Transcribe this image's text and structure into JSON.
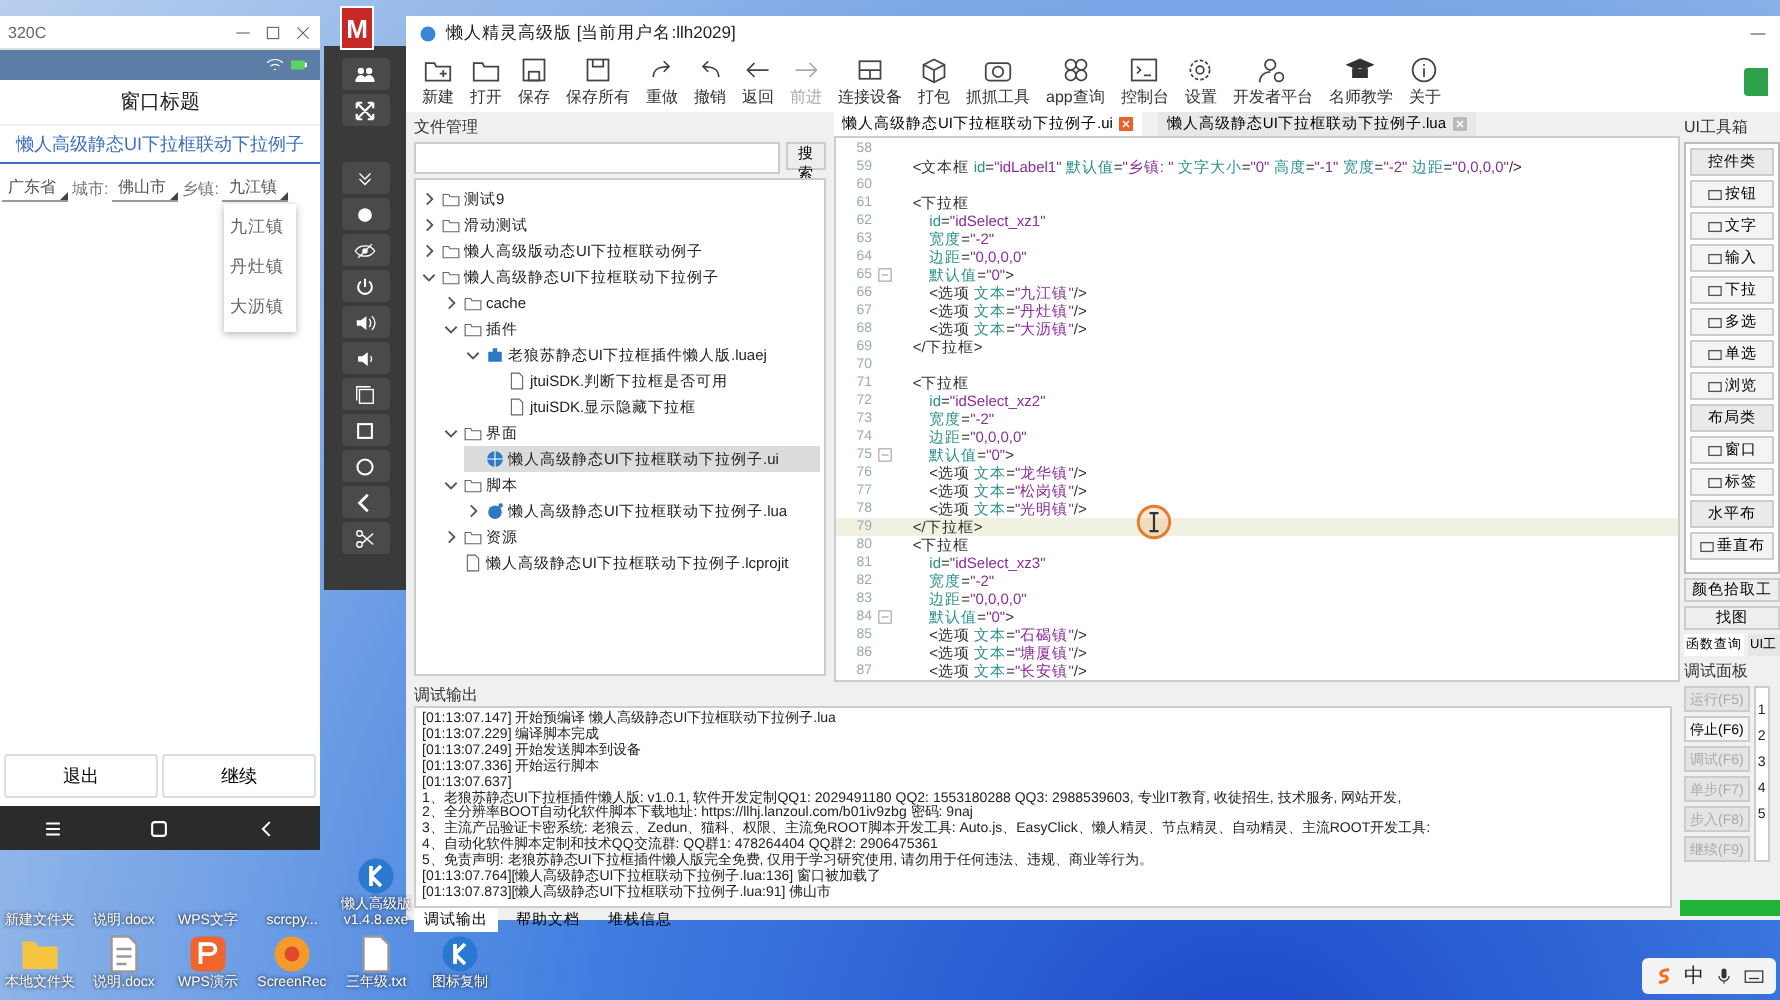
{
  "phone_window": {
    "title": "320C",
    "header": "窗口标题",
    "subtitle": "懒人高级静态UI下拉框联动下拉例子",
    "controls": [
      {
        "kind": "select",
        "text": "广东省"
      },
      {
        "kind": "label",
        "text": "城市:"
      },
      {
        "kind": "select",
        "text": "佛山市"
      },
      {
        "kind": "label",
        "text": "乡镇:"
      },
      {
        "kind": "select",
        "text": "九江镇"
      }
    ],
    "dropdown": [
      {
        "label": "九江镇",
        "selected": false
      },
      {
        "label": "丹灶镇",
        "selected": false
      },
      {
        "label": "大沥镇",
        "selected": false
      }
    ],
    "buttons": [
      "退出",
      "继续"
    ]
  },
  "desktop_badge": "M",
  "ide": {
    "title": "懒人精灵高级版 [当前用户名:llh2029]",
    "toolbar": [
      {
        "label": "新建",
        "disabled": false
      },
      {
        "label": "打开",
        "disabled": false
      },
      {
        "label": "保存",
        "disabled": false
      },
      {
        "label": "保存所有",
        "disabled": false
      },
      {
        "label": "重做",
        "disabled": false
      },
      {
        "label": "撤销",
        "disabled": false
      },
      {
        "label": "返回",
        "disabled": false
      },
      {
        "label": "前进",
        "disabled": true
      },
      {
        "label": "连接设备",
        "disabled": false
      },
      {
        "label": "打包",
        "disabled": false
      },
      {
        "label": "抓抓工具",
        "disabled": false
      },
      {
        "label": "app查询",
        "disabled": false
      },
      {
        "label": "控制台",
        "disabled": false
      },
      {
        "label": "设置",
        "disabled": false
      },
      {
        "label": "开发者平台",
        "disabled": false
      },
      {
        "label": "名师教学",
        "disabled": false
      },
      {
        "label": "关于",
        "disabled": false
      }
    ],
    "file_panel": {
      "title": "文件管理",
      "search_button": "搜索",
      "tree": [
        {
          "label": "测试9",
          "kind": "folder",
          "expanded": false,
          "selected": false
        },
        {
          "label": "滑动测试",
          "kind": "folder",
          "expanded": false,
          "selected": false
        },
        {
          "label": "懒人高级版动态UI下拉框联动例子",
          "kind": "folder",
          "expanded": false,
          "selected": false
        },
        {
          "label": "懒人高级静态UI下拉框联动下拉例子",
          "kind": "folder",
          "expanded": true,
          "selected": false,
          "children": [
            {
              "label": "cache",
              "kind": "folder",
              "expanded": false,
              "selected": false
            },
            {
              "label": "插件",
              "kind": "folder",
              "expanded": true,
              "selected": false,
              "children": [
                {
                  "label": "老狼苏静态UI下拉框插件懒人版.luaej",
                  "kind": "plugin",
                  "expanded": true,
                  "selected": false,
                  "children": [
                    {
                      "label": "jtuiSDK.判断下拉框是否可用",
                      "kind": "file",
                      "selected": false
                    },
                    {
                      "label": "jtuiSDK.显示隐藏下拉框",
                      "kind": "file",
                      "selected": false
                    }
                  ]
                }
              ]
            },
            {
              "label": "界面",
              "kind": "folder",
              "expanded": true,
              "selected": false,
              "children": [
                {
                  "label": "懒人高级静态UI下拉框联动下拉例子.ui",
                  "kind": "ui",
                  "selected": true
                }
              ]
            },
            {
              "label": "脚本",
              "kind": "folder",
              "expanded": true,
              "selected": false,
              "children": [
                {
                  "label": "懒人高级静态UI下拉框联动下拉例子.lua",
                  "kind": "lua",
                  "expanded": false,
                  "selected": false
                }
              ]
            },
            {
              "label": "资源",
              "kind": "folder",
              "expanded": false,
              "selected": false
            },
            {
              "label": "懒人高级静态UI下拉框联动下拉例子.lcprojit",
              "kind": "file",
              "selected": false
            }
          ]
        }
      ]
    },
    "editor": {
      "tabs": [
        {
          "label": "懒人高级静态UI下拉框联动下拉例子.ui",
          "selected": true
        },
        {
          "label": "懒人高级静态UI下拉框联动下拉例子.lua",
          "selected": false
        }
      ],
      "lines": [
        {
          "number": "58",
          "fold": false,
          "current": false
        },
        {
          "number": "59",
          "text": "    <文本框 id=\"idLabel1\" 默认值=\"乡镇: \" 文字大小=\"0\" 高度=\"-1\" 宽度=\"-2\" 边距=\"0,0,0,0\"/>",
          "fold": false,
          "current": false
        },
        {
          "number": "60",
          "fold": false,
          "current": false
        },
        {
          "number": "61",
          "text": "    <下拉框",
          "fold": false,
          "current": false
        },
        {
          "number": "62",
          "text": "        id=\"idSelect_xz1\"",
          "fold": false,
          "current": false
        },
        {
          "number": "63",
          "text": "        宽度=\"-2\"",
          "fold": false,
          "current": false
        },
        {
          "number": "64",
          "text": "        边距=\"0,0,0,0\"",
          "fold": false,
          "current": false
        },
        {
          "number": "65",
          "text": "        默认值=\"0\">",
          "fold": true,
          "current": false
        },
        {
          "number": "66",
          "text": "        <选项 文本=\"九江镇\"/>",
          "fold": false,
          "current": false
        },
        {
          "number": "67",
          "text": "        <选项 文本=\"丹灶镇\"/>",
          "fold": false,
          "current": false
        },
        {
          "number": "68",
          "text": "        <选项 文本=\"大沥镇\"/>",
          "fold": false,
          "current": false
        },
        {
          "number": "69",
          "text": "    </下拉框>",
          "fold": false,
          "current": false
        },
        {
          "number": "70",
          "fold": false,
          "current": false
        },
        {
          "number": "71",
          "text": "    <下拉框",
          "fold": false,
          "current": false
        },
        {
          "number": "72",
          "text": "        id=\"idSelect_xz2\"",
          "fold": false,
          "current": false
        },
        {
          "number": "73",
          "text": "        宽度=\"-2\"",
          "fold": false,
          "current": false
        },
        {
          "number": "74",
          "text": "        边距=\"0,0,0,0\"",
          "fold": false,
          "current": false
        },
        {
          "number": "75",
          "text": "        默认值=\"0\">",
          "fold": true,
          "current": false
        },
        {
          "number": "76",
          "text": "        <选项 文本=\"龙华镇\"/>",
          "fold": false,
          "current": false
        },
        {
          "number": "77",
          "text": "        <选项 文本=\"松岗镇\"/>",
          "fold": false,
          "current": false
        },
        {
          "number": "78",
          "text": "        <选项 文本=\"光明镇\"/>",
          "fold": false,
          "current": false
        },
        {
          "number": "79",
          "text": "    </下拉框>",
          "fold": false,
          "current": true
        },
        {
          "number": "80",
          "text": "    <下拉框",
          "fold": false,
          "current": false
        },
        {
          "number": "81",
          "text": "        id=\"idSelect_xz3\"",
          "fold": false,
          "current": false
        },
        {
          "number": "82",
          "text": "        宽度=\"-2\"",
          "fold": false,
          "current": false
        },
        {
          "number": "83",
          "text": "        边距=\"0,0,0,0\"",
          "fold": false,
          "current": false
        },
        {
          "number": "84",
          "text": "        默认值=\"0\">",
          "fold": true,
          "current": false
        },
        {
          "number": "85",
          "text": "        <选项 文本=\"石碣镇\"/>",
          "fold": false,
          "current": false
        },
        {
          "number": "86",
          "text": "        <选项 文本=\"塘厦镇\"/>",
          "fold": false,
          "current": false
        },
        {
          "number": "87",
          "text": "        <选项 文本=\"长安镇\"/>",
          "fold": false,
          "current": false
        }
      ]
    },
    "debug_output": {
      "title": "调试输出",
      "lines": [
        "[01:13:07.147] 开始预编译 懒人高级静态UI下拉框联动下拉例子.lua",
        "[01:13:07.229] 编译脚本完成",
        "[01:13:07.249] 开始发送脚本到设备",
        "[01:13:07.336] 开始运行脚本",
        "[01:13:07.637]",
        "1、老狼苏静态UI下拉框插件懒人版: v1.0.1, 软件开发定制QQ1: 2029491180 QQ2: 1553180288 QQ3: 2988539603, 专业IT教育, 收徒招生, 技术服务, 网站开发,",
        "2、全分辨率BOOT自动化软件脚本下载地址: https://llhj.lanzoul.com/b01iv9zbg 密码: 9naj",
        "3、主流产品验证卡密系统: 老狼云、Zedun、猫科、权限、主流免ROOT脚本开发工具: Auto.js、EasyClick、懒人精灵、节点精灵、自动精灵、主流ROOT开发工具:",
        "4、自动化软件脚本定制和技术QQ交流群: QQ群1: 478264404  QQ群2: 2906475361",
        "5、免责声明: 老狼苏静态UI下拉框插件懒人版完全免费, 仅用于学习研究使用, 请勿用于任何违法、违规、商业等行为。",
        "[01:13:07.764][懒人高级静态UI下拉框联动下拉例子.lua:136] 窗口被加载了",
        "[01:13:07.873][懒人高级静态UI下拉框联动下拉例子.lua:91] 佛山市"
      ],
      "tabs": [
        {
          "label": "调试输出",
          "selected": true
        },
        {
          "label": "帮助文档",
          "selected": false
        },
        {
          "label": "堆栈信息",
          "selected": false
        }
      ]
    },
    "toolbox": {
      "title": "UI工具箱",
      "items": [
        {
          "kind": "header",
          "label": "控件类"
        },
        {
          "kind": "item",
          "label": "按钮"
        },
        {
          "kind": "item",
          "label": "文字"
        },
        {
          "kind": "item",
          "label": "输入"
        },
        {
          "kind": "item",
          "label": "下拉"
        },
        {
          "kind": "item",
          "label": "多选"
        },
        {
          "kind": "item",
          "label": "单选"
        },
        {
          "kind": "item",
          "label": "浏览"
        },
        {
          "kind": "header",
          "label": "布局类"
        },
        {
          "kind": "item",
          "label": "窗口"
        },
        {
          "kind": "item",
          "label": "标签"
        },
        {
          "kind": "header",
          "label": "水平布"
        },
        {
          "kind": "item",
          "label": "垂直布"
        }
      ],
      "extra_buttons": [
        "颜色拾取工",
        "找图"
      ],
      "tabs": [
        {
          "label": "函数查询",
          "selected": true
        },
        {
          "label": "UI工",
          "selected": false
        }
      ],
      "debug_panel": {
        "title": "调试面板",
        "buttons": [
          {
            "label": "运行(F5)",
            "disabled": true
          },
          {
            "label": "停止(F6)",
            "disabled": false
          },
          {
            "label": "调试(F6)",
            "disabled": true
          },
          {
            "label": "单步(F7)",
            "disabled": true
          },
          {
            "label": "步入(F8)",
            "disabled": true
          },
          {
            "label": "继续(F9)",
            "disabled": true
          }
        ],
        "line_numbers": [
          "1",
          "2",
          "3",
          "4",
          "5"
        ]
      }
    }
  },
  "desktop_icons": [
    {
      "label": "新建文件夹",
      "kind": "covered"
    },
    {
      "label": "说明.docx",
      "kind": "covered"
    },
    {
      "label": "WPS文字",
      "kind": "covered"
    },
    {
      "label": "scrcpy...",
      "kind": "covered"
    },
    {
      "label": "懒人高级版 v1.4.8.exe",
      "kind": "app"
    },
    {
      "label": "本地文件夹",
      "kind": "folder"
    },
    {
      "label": "说明.docx",
      "kind": "document"
    },
    {
      "label": "WPS演示",
      "kind": "wps"
    },
    {
      "label": "ScreenRec",
      "kind": "recorder"
    },
    {
      "label": "三年级.txt",
      "kind": "text"
    },
    {
      "label": "图标复制",
      "kind": "app"
    }
  ],
  "tray": {
    "input_method": "中"
  }
}
